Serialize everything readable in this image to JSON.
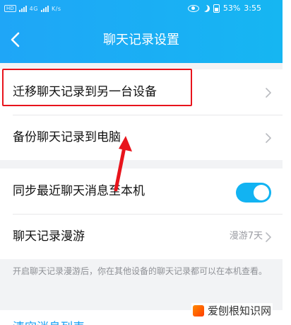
{
  "status_bar": {
    "hd_badge": "HD",
    "network": "4G",
    "speed": "K/s",
    "battery_percent": "53%",
    "time": "3:55"
  },
  "header": {
    "title": "聊天记录设置",
    "background_color": "#1fa6f7"
  },
  "group1": {
    "items": [
      {
        "label": "迁移聊天记录到另一台设备"
      },
      {
        "label": "备份聊天记录到电脑"
      }
    ]
  },
  "group2": {
    "sync_label": "同步最近聊天消息至本机",
    "sync_enabled": true,
    "roaming_label": "聊天记录漫游",
    "roaming_value": "漫游7天"
  },
  "hint_text": "开启聊天记录漫游后，你在其他设备的聊天记录都可以在本机查看。",
  "clear_label": "清空消息列表",
  "watermark_text": "爱刨根知识网",
  "colors": {
    "accent": "#1fa6f7",
    "toggle_on": "#12b3f2",
    "annotation": "#e8141c"
  }
}
